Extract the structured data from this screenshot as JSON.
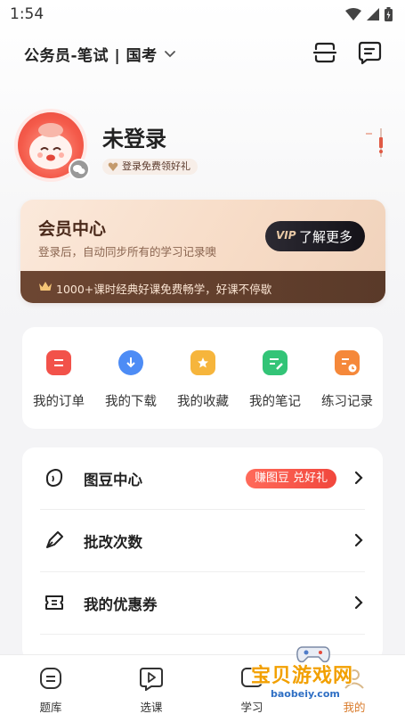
{
  "status_bar": {
    "time": "1:54"
  },
  "header": {
    "exam_title": "公务员-笔试 | 国考"
  },
  "profile": {
    "name": "未登录",
    "tag": "登录免费领好礼"
  },
  "vip": {
    "title": "会员中心",
    "subtitle": "登录后，自动同步所有的学习记录噢",
    "button_logo": "VIP",
    "button_label": "了解更多",
    "strip_text": "1000+课时经典好课免费畅学，好课不停歇"
  },
  "quick_actions": [
    {
      "label": "我的订单",
      "color": "#f2524a"
    },
    {
      "label": "我的下载",
      "color": "#4d8cf5"
    },
    {
      "label": "我的收藏",
      "color": "#f6b53c"
    },
    {
      "label": "我的笔记",
      "color": "#33c477"
    },
    {
      "label": "练习记录",
      "color": "#f5883a"
    }
  ],
  "menu": [
    {
      "label": "图豆中心",
      "badge": "赚图豆 兑好礼"
    },
    {
      "label": "批改次数"
    },
    {
      "label": "我的优惠券"
    }
  ],
  "bottom_nav": [
    {
      "label": "题库"
    },
    {
      "label": "选课"
    },
    {
      "label": "学习"
    },
    {
      "label": "我的"
    }
  ],
  "watermark": {
    "text": "宝贝游戏网",
    "url": "baobeiy.com"
  }
}
